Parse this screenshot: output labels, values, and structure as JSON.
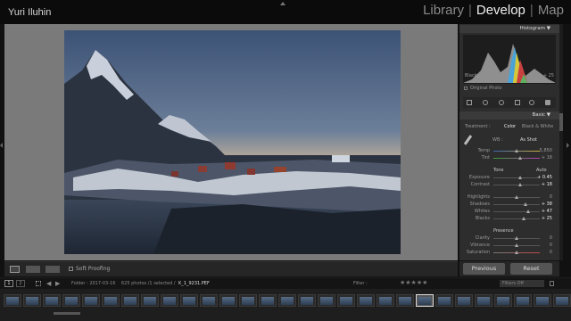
{
  "header": {
    "user": "Yuri Iluhin",
    "modules": [
      "Library",
      "Develop",
      "Map"
    ],
    "active_module": "Develop",
    "sep": "|"
  },
  "toolbar": {
    "soft_proofing": "Soft Proofing"
  },
  "right_panel": {
    "histogram_title": "Histogram",
    "hist_left": "Blacks",
    "hist_right": "+ 25",
    "original_photo": "Original Photo",
    "basic_title": "Basic",
    "treatment_label": "Treatment :",
    "treatment_color": "Color",
    "treatment_bw": "Black & White",
    "wb_label": "WB :",
    "wb_value": "As Shot",
    "temp": {
      "label": "Temp",
      "value": "5,850"
    },
    "tint": {
      "label": "Tint",
      "value": "+ 18"
    },
    "tone_label": "Tone",
    "tone_auto": "Auto",
    "exposure": {
      "label": "Exposure",
      "value": "+ 0.45"
    },
    "contrast": {
      "label": "Contrast",
      "value": "+ 18"
    },
    "highlights": {
      "label": "Highlights",
      "value": "0"
    },
    "shadows": {
      "label": "Shadows",
      "value": "+ 38"
    },
    "whites": {
      "label": "Whites",
      "value": "+ 47"
    },
    "blacks": {
      "label": "Blacks",
      "value": "+ 25"
    },
    "presence_label": "Presence",
    "clarity": {
      "label": "Clarity",
      "value": "0"
    },
    "vibrance": {
      "label": "Vibrance",
      "value": "0"
    },
    "saturation": {
      "label": "Saturation",
      "value": "0"
    },
    "previous": "Previous",
    "reset": "Reset"
  },
  "filmstrip": {
    "page1": "1",
    "page2": "2",
    "source": "Folder : 2017-03-16",
    "count": "625 photos /1 selected /",
    "filename": "K_1_9231.PEF",
    "filter_label": "Filter :",
    "filter_value": "Filters Off"
  }
}
